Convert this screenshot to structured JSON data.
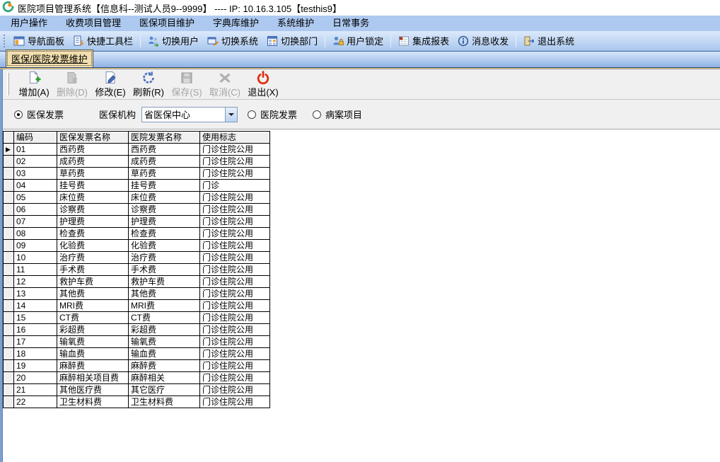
{
  "titlebar": {
    "title": "医院项目管理系统【信息科--测试人员9--9999】 ---- IP: 10.16.3.105【testhis9】"
  },
  "menubar": {
    "items": [
      "用户操作",
      "收费项目管理",
      "医保项目维护",
      "字典库维护",
      "系统维护",
      "日常事务"
    ]
  },
  "toolbar": {
    "groups": [
      [
        {
          "label": "导航面板",
          "icon": "nav-panel-icon"
        },
        {
          "label": "快捷工具栏",
          "icon": "quick-toolbar-icon"
        }
      ],
      [
        {
          "label": "切换用户",
          "icon": "switch-user-icon"
        },
        {
          "label": "切换系统",
          "icon": "switch-system-icon"
        },
        {
          "label": "切换部门",
          "icon": "switch-dept-icon"
        }
      ],
      [
        {
          "label": "用户锁定",
          "icon": "user-lock-icon"
        }
      ],
      [
        {
          "label": "集成报表",
          "icon": "report-icon"
        },
        {
          "label": "消息收发",
          "icon": "message-icon"
        }
      ],
      [
        {
          "label": "退出系统",
          "icon": "exit-door-icon"
        }
      ]
    ]
  },
  "tabs": {
    "active_label": "医保/医院发票维护"
  },
  "action_bar": {
    "buttons": [
      {
        "label": "增加(A)",
        "icon": "add-icon",
        "enabled": true
      },
      {
        "label": "删除(D)",
        "icon": "delete-icon",
        "enabled": false
      },
      {
        "label": "修改(E)",
        "icon": "edit-icon",
        "enabled": true
      },
      {
        "label": "刷新(R)",
        "icon": "refresh-icon",
        "enabled": true
      },
      {
        "label": "保存(S)",
        "icon": "save-icon",
        "enabled": false
      },
      {
        "label": "取消(C)",
        "icon": "cancel-icon",
        "enabled": false
      },
      {
        "label": "退出(X)",
        "icon": "power-icon",
        "enabled": true
      }
    ]
  },
  "filter_bar": {
    "radio_medins_invoice": {
      "label": "医保发票",
      "selected": true
    },
    "org_label": "医保机构",
    "org_value": "省医保中心",
    "radio_hospital_invoice": {
      "label": "医院发票",
      "selected": false
    },
    "radio_medical_record": {
      "label": "病案项目",
      "selected": false
    }
  },
  "grid": {
    "columns": [
      "编码",
      "医保发票名称",
      "医院发票名称",
      "使用标志"
    ],
    "selected_row": 0,
    "rows": [
      [
        "01",
        "西药费",
        "西药费",
        "门诊住院公用"
      ],
      [
        "02",
        "成药费",
        "成药费",
        "门诊住院公用"
      ],
      [
        "03",
        "草药费",
        "草药费",
        "门诊住院公用"
      ],
      [
        "04",
        "挂号费",
        "挂号费",
        "门诊"
      ],
      [
        "05",
        "床位费",
        "床位费",
        "门诊住院公用"
      ],
      [
        "06",
        "诊察费",
        "诊察费",
        "门诊住院公用"
      ],
      [
        "07",
        "护理费",
        "护理费",
        "门诊住院公用"
      ],
      [
        "08",
        "检查费",
        "检查费",
        "门诊住院公用"
      ],
      [
        "09",
        "化验费",
        "化验费",
        "门诊住院公用"
      ],
      [
        "10",
        "治疗费",
        "治疗费",
        "门诊住院公用"
      ],
      [
        "11",
        "手术费",
        "手术费",
        "门诊住院公用"
      ],
      [
        "12",
        "救护车费",
        "救护车费",
        "门诊住院公用"
      ],
      [
        "13",
        "其他费",
        "其他费",
        "门诊住院公用"
      ],
      [
        "14",
        "MRI费",
        "MRI费",
        "门诊住院公用"
      ],
      [
        "15",
        "CT费",
        "CT费",
        "门诊住院公用"
      ],
      [
        "16",
        "彩超费",
        "彩超费",
        "门诊住院公用"
      ],
      [
        "17",
        "输氧费",
        "输氧费",
        "门诊住院公用"
      ],
      [
        "18",
        "输血费",
        "输血费",
        "门诊住院公用"
      ],
      [
        "19",
        "麻醉费",
        "麻醉费",
        "门诊住院公用"
      ],
      [
        "20",
        "麻醉相关项目费",
        "麻醉相关",
        "门诊住院公用"
      ],
      [
        "21",
        "其他医疗费",
        "其它医疗",
        "门诊住院公用"
      ],
      [
        "22",
        "卫生材料费",
        "卫生材料费",
        "门诊住院公用"
      ]
    ]
  },
  "colors": {
    "menubar_bg": "#adc9f0",
    "toolbar_bg_top": "#dce9fb",
    "toolbar_bg_bottom": "#aac8ee",
    "tab_active_bg": "#f2dfae",
    "panel_bg": "#f0f0f0",
    "left_strip": "#7d9fd0",
    "disabled_text": "#a3a3a3",
    "power_red": "#e03010",
    "add_green": "#2ca02c",
    "edit_blue": "#4a6fc0"
  }
}
